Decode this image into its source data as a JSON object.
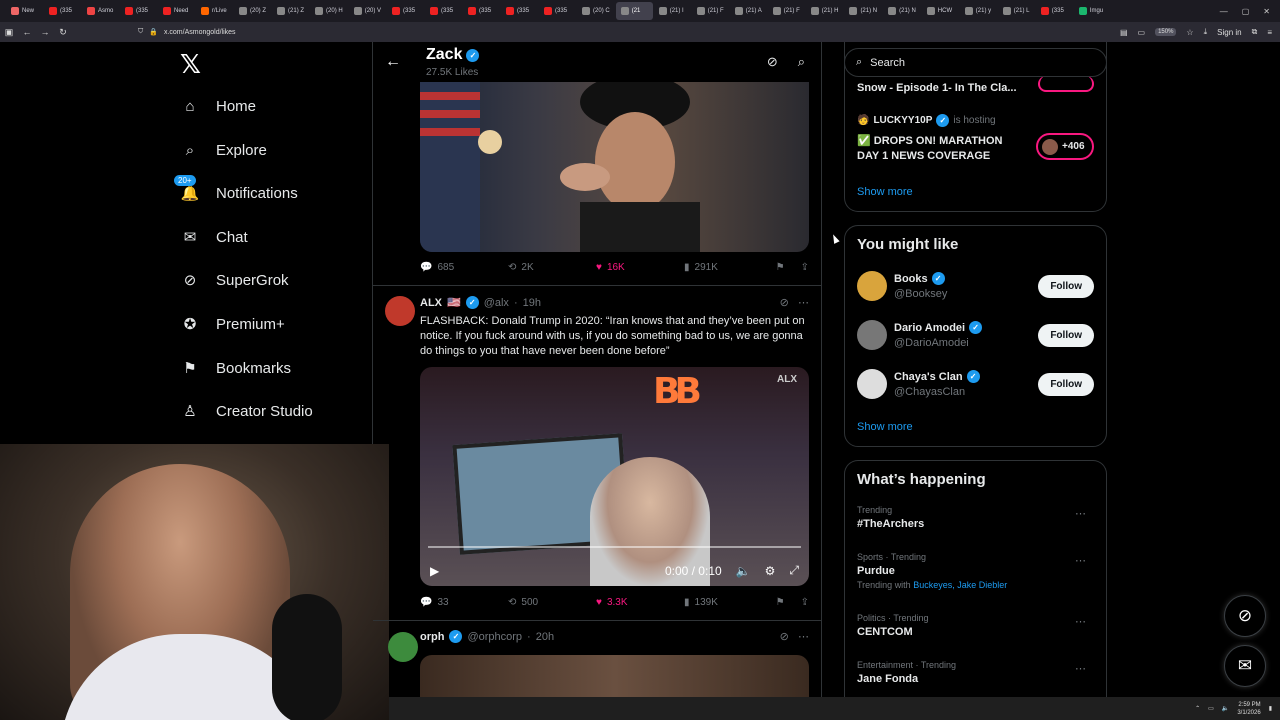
{
  "browser": {
    "tabs": [
      {
        "label": "New",
        "color": "#e66"
      },
      {
        "label": "(335",
        "color": "#e22"
      },
      {
        "label": "Asmo",
        "color": "#e44"
      },
      {
        "label": "(335",
        "color": "#e22"
      },
      {
        "label": "Need",
        "color": "#e22"
      },
      {
        "label": "r/Live",
        "color": "#f60"
      },
      {
        "label": "(20) Z",
        "color": "#888"
      },
      {
        "label": "(21) Z",
        "color": "#888"
      },
      {
        "label": "(20) H",
        "color": "#888"
      },
      {
        "label": "(20) V",
        "color": "#888"
      },
      {
        "label": "(335",
        "color": "#e22"
      },
      {
        "label": "(335",
        "color": "#e22"
      },
      {
        "label": "(335",
        "color": "#e22"
      },
      {
        "label": "(335",
        "color": "#e22"
      },
      {
        "label": "(335",
        "color": "#e22"
      },
      {
        "label": "(20) C",
        "color": "#888"
      },
      {
        "label": "(21",
        "color": "#888",
        "active": true
      },
      {
        "label": "(21) I",
        "color": "#888"
      },
      {
        "label": "(21) F",
        "color": "#888"
      },
      {
        "label": "(21) A",
        "color": "#888"
      },
      {
        "label": "(21) F",
        "color": "#888"
      },
      {
        "label": "(21) H",
        "color": "#888"
      },
      {
        "label": "(21) N",
        "color": "#888"
      },
      {
        "label": "(21) N",
        "color": "#888"
      },
      {
        "label": "HCW",
        "color": "#888"
      },
      {
        "label": "(21) y",
        "color": "#888"
      },
      {
        "label": "(21) L",
        "color": "#888"
      },
      {
        "label": "(335",
        "color": "#e22"
      },
      {
        "label": "Imgu",
        "color": "#1bb76e"
      }
    ],
    "url": "x.com/Asmongold/likes",
    "zoom": "150%",
    "signin": "Sign in"
  },
  "sidebar": {
    "items": [
      {
        "label": "Home",
        "icon": "home-icon"
      },
      {
        "label": "Explore",
        "icon": "search-icon"
      },
      {
        "label": "Notifications",
        "icon": "bell-icon",
        "badge": "20+"
      },
      {
        "label": "Chat",
        "icon": "mail-icon"
      },
      {
        "label": "SuperGrok",
        "icon": "grok-icon"
      },
      {
        "label": "Premium+",
        "icon": "premium-icon"
      },
      {
        "label": "Bookmarks",
        "icon": "bookmark-icon"
      },
      {
        "label": "Creator Studio",
        "icon": "creator-studio-icon"
      }
    ]
  },
  "header": {
    "name": "Zack",
    "sub": "27.5K Likes"
  },
  "post1": {
    "replies": "685",
    "reposts": "2K",
    "likes": "16K",
    "views": "291K"
  },
  "post2": {
    "name": "ALX",
    "flags": "🇺🇸",
    "handle": "@alx",
    "time": "19h",
    "text": "FLASHBACK: Donald Trump in 2020: “Iran knows that and they’ve been put on notice. If you fuck around with us, if you do something bad to us, we are gonna do things to you that have never been done before”",
    "watermark": "ALX",
    "video_time": "0:00 / 0:10",
    "replies": "33",
    "reposts": "500",
    "likes": "3.3K",
    "views": "139K"
  },
  "post3": {
    "name": "orph",
    "handle": "@orphcorp",
    "time": "20h"
  },
  "live": {
    "partial_title": "Snow - Episode 1- In The Cla...",
    "host": "LUCKYY10P",
    "host_suffix": "is hosting",
    "title": "✅ DROPS ON! MARATHON DAY 1 NEWS COVERAGE",
    "count": "+406",
    "show_more": "Show more"
  },
  "search": {
    "placeholder": "Search"
  },
  "might_like": {
    "title": "You might like",
    "users": [
      {
        "name": "Books",
        "handle": "@Booksey",
        "follow": "Follow",
        "color": "#d9a43c"
      },
      {
        "name": "Dario Amodei",
        "handle": "@DarioAmodei",
        "follow": "Follow",
        "color": "#777"
      },
      {
        "name": "Chaya's Clan",
        "handle": "@ChayasClan",
        "follow": "Follow",
        "color": "#ddd"
      }
    ],
    "show_more": "Show more"
  },
  "happening": {
    "title": "What’s happening",
    "trends": [
      {
        "meta": "Trending",
        "title": "#TheArchers"
      },
      {
        "meta": "Sports · Trending",
        "title": "Purdue",
        "with_label": "Trending with",
        "with": "Buckeyes, Jake Diebler"
      },
      {
        "meta": "Politics · Trending",
        "title": "CENTCOM"
      },
      {
        "meta": "Entertainment · Trending",
        "title": "Jane Fonda"
      }
    ]
  },
  "taskbar": {
    "time": "2:59 PM",
    "date": "3/1/2026"
  }
}
